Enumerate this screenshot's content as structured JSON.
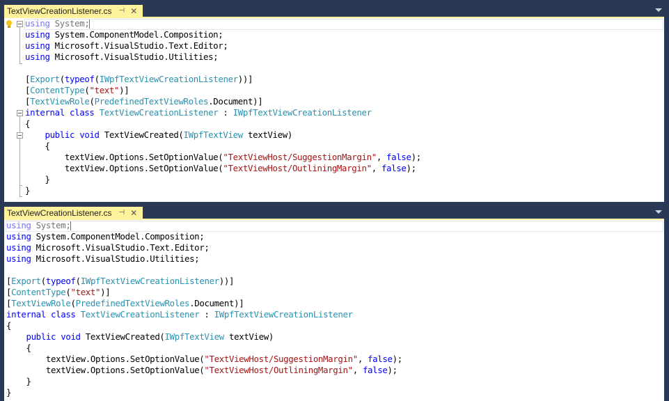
{
  "editors": [
    {
      "tab": {
        "label": "TextViewCreationListener.cs",
        "pin_icon": "pin-icon",
        "close_icon": "close-icon"
      },
      "show_margin": true
    },
    {
      "tab": {
        "label": "TextViewCreationListener.cs",
        "pin_icon": "pin-icon",
        "close_icon": "close-icon"
      },
      "show_margin": false
    }
  ],
  "code": {
    "l1_kw": "using",
    "l1_rest": " System;",
    "l2_kw": "using",
    "l2_rest": " System.ComponentModel.Composition;",
    "l3_kw": "using",
    "l3_rest": " Microsoft.VisualStudio.Text.Editor;",
    "l4_kw": "using",
    "l4_rest": " Microsoft.VisualStudio.Utilities;",
    "l6_a": "[",
    "l6_ty1": "Export",
    "l6_b": "(",
    "l6_kw": "typeof",
    "l6_c": "(",
    "l6_ty2": "IWpfTextViewCreationListener",
    "l6_d": "))]",
    "l7_a": "[",
    "l7_ty": "ContentType",
    "l7_b": "(",
    "l7_st": "\"text\"",
    "l7_c": ")]",
    "l8_a": "[",
    "l8_ty1": "TextViewRole",
    "l8_b": "(",
    "l8_ty2": "PredefinedTextViewRoles",
    "l8_c": ".Document)]",
    "l9_kw": "internal class",
    "l9_sp": " ",
    "l9_ty1": "TextViewCreationListener",
    "l9_b": " : ",
    "l9_ty2": "IWpfTextViewCreationListener",
    "l10": "{",
    "l11_ind": "    ",
    "l11_kw": "public void",
    "l11_a": " TextViewCreated(",
    "l11_ty": "IWpfTextView",
    "l11_b": " textView)",
    "l12": "    {",
    "l13_a": "        textView.Options.SetOptionValue(",
    "l13_st": "\"TextViewHost/SuggestionMargin\"",
    "l13_b": ", ",
    "l13_kw": "false",
    "l13_c": ");",
    "l14_a": "        textView.Options.SetOptionValue(",
    "l14_st": "\"TextViewHost/OutliningMargin\"",
    "l14_b": ", ",
    "l14_kw": "false",
    "l14_c": ");",
    "l15": "    }",
    "l16": "}"
  },
  "colors": {
    "keyword": "#0000ff",
    "type": "#2b91af",
    "string": "#a31515",
    "tab_active": "#fff29d",
    "chrome": "#293955"
  }
}
